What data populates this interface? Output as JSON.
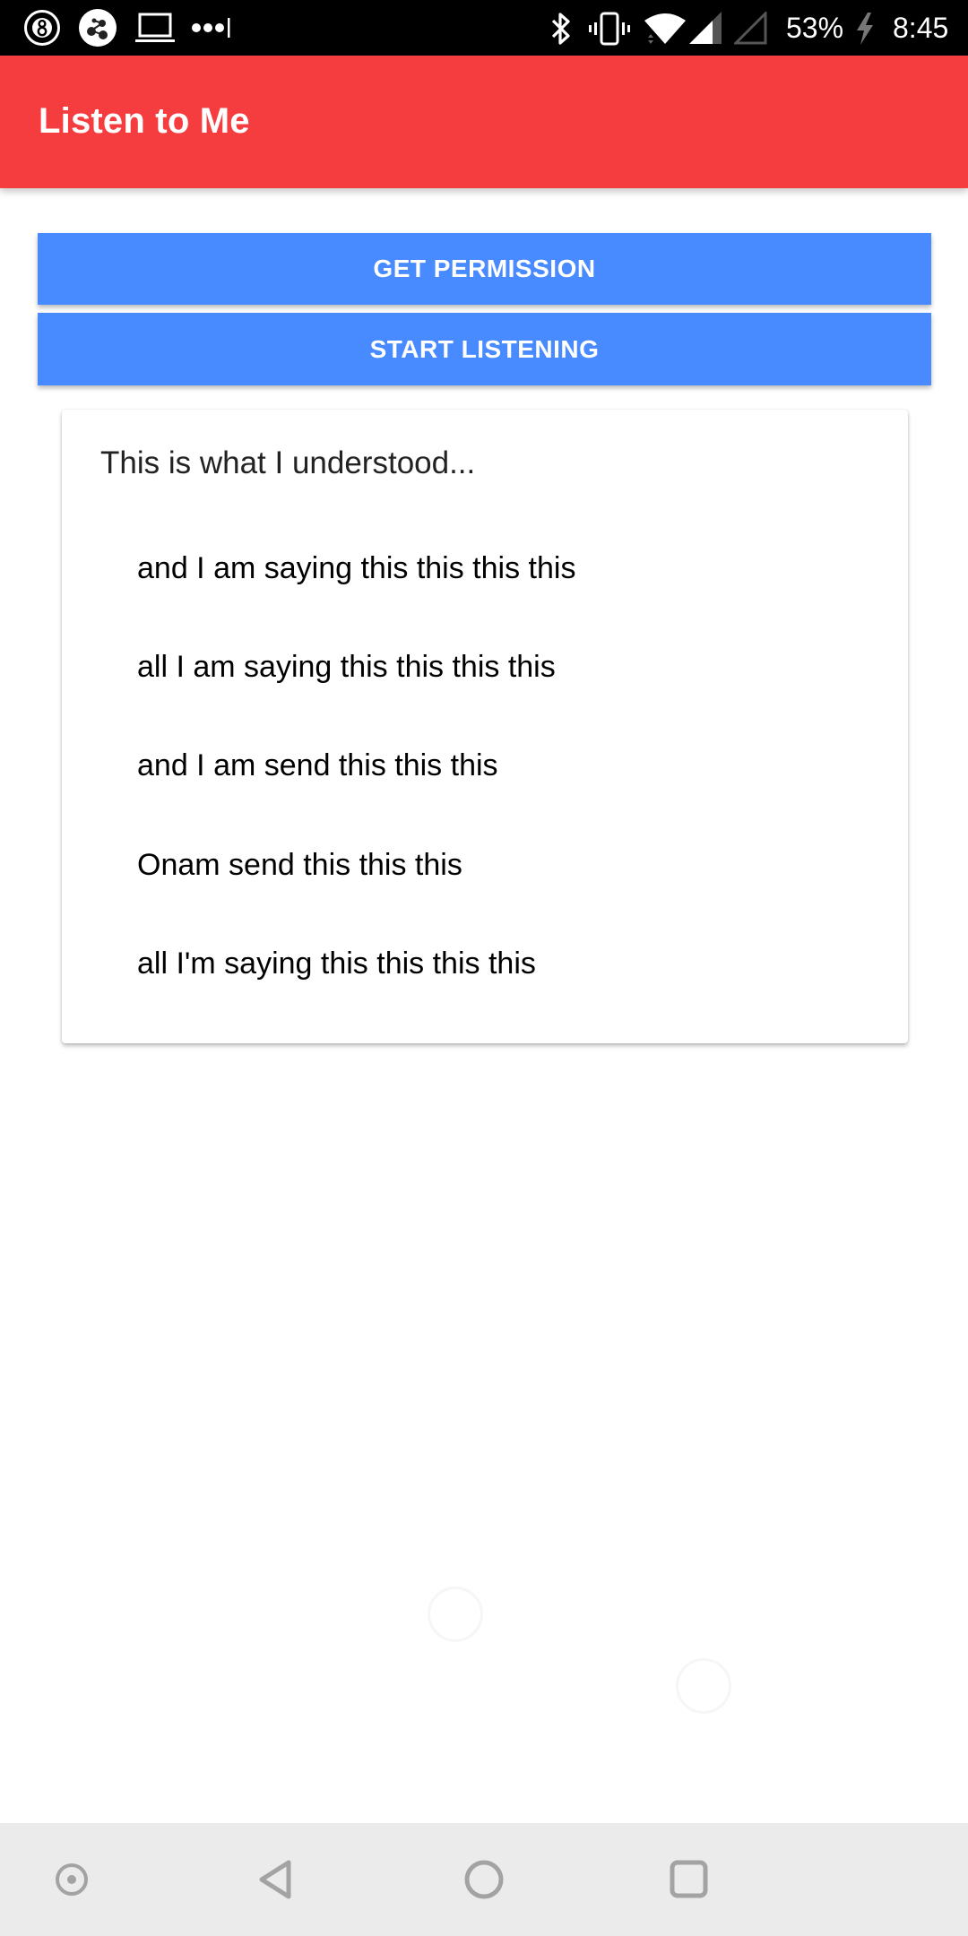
{
  "status_bar": {
    "left_icons": [
      "8-ball-notification-icon",
      "share-notification-icon",
      "laptop-notification-icon",
      "more-notifications-icon"
    ],
    "right_icons": [
      "bluetooth-icon",
      "vibrate-icon",
      "wifi-icon",
      "signal-sim1-icon",
      "signal-sim2-icon",
      "charging-icon"
    ],
    "battery": "53%",
    "time": "8:45"
  },
  "app_bar": {
    "title": "Listen to Me",
    "color": "#f53d3f"
  },
  "actions": {
    "get_permission_label": "GET PERMISSION",
    "start_listening_label": "START LISTENING",
    "button_color": "#488aff"
  },
  "results": {
    "heading": "This is what I understood...",
    "items": [
      "and I am saying this this this this",
      "all I am saying this this this this",
      "and I am send this this this",
      "Onam send this this this",
      "all I'm saying this this this this"
    ]
  },
  "nav_bar": {
    "buttons": [
      "assistant-icon",
      "back-icon",
      "home-icon",
      "recents-icon"
    ]
  }
}
